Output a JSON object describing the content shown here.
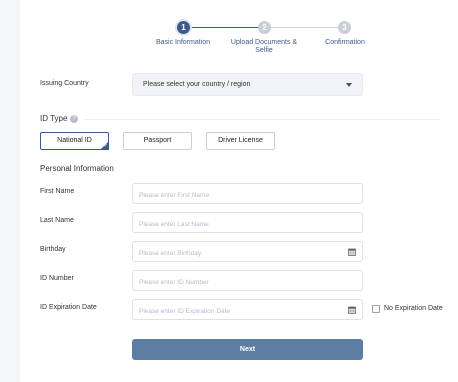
{
  "stepper": {
    "steps": [
      {
        "number": "1",
        "label": "Basic Information"
      },
      {
        "number": "2",
        "label": "Upload Documents & Selfie"
      },
      {
        "number": "3",
        "label": "Confirmation"
      }
    ],
    "current_step": 1
  },
  "issuing_country": {
    "label": "Issuing Country",
    "value": "Please select your country / region"
  },
  "id_type": {
    "title": "ID Type",
    "help_icon": "question-icon",
    "options": [
      "National ID",
      "Passport",
      "Driver License"
    ],
    "selected": "National ID"
  },
  "personal_info": {
    "title": "Personal Information",
    "fields": [
      {
        "label": "First Name",
        "placeholder": "Please enter First Name",
        "value": ""
      },
      {
        "label": "Last Name",
        "placeholder": "Please enter Last Name",
        "value": ""
      },
      {
        "label": "Birthday",
        "placeholder": "Please enter Birthday",
        "value": "",
        "icon": "calendar-icon"
      },
      {
        "label": "ID Number",
        "placeholder": "Please enter ID Number",
        "value": ""
      },
      {
        "label": "ID Expiration Date",
        "placeholder": "Please enter ID Expiration Date",
        "value": "",
        "icon": "calendar-icon"
      }
    ],
    "no_expiration_label": "No Expiration Date",
    "no_expiration_checked": false
  },
  "next_label": "Next",
  "colors": {
    "accent": "#3d5a8a",
    "button": "#5d7da3",
    "inactive_step": "#c8cfd9"
  }
}
